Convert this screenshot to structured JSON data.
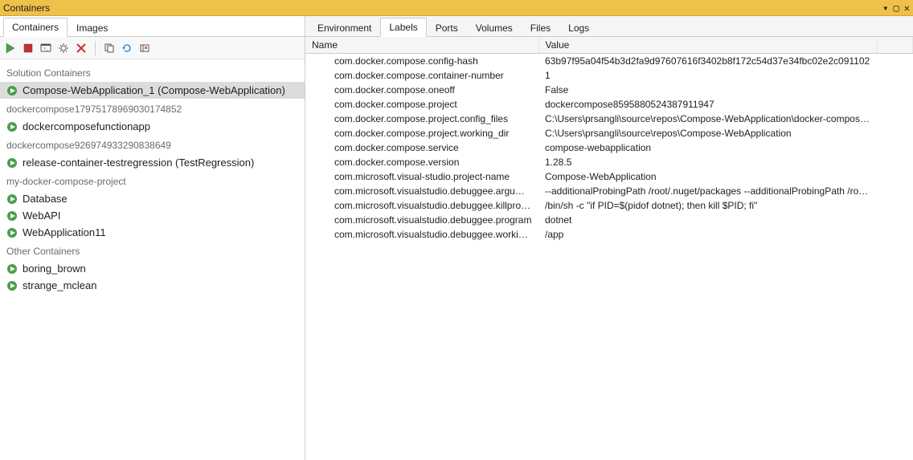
{
  "window": {
    "title": "Containers"
  },
  "leftTabs": [
    {
      "label": "Containers",
      "active": true
    },
    {
      "label": "Images",
      "active": false
    }
  ],
  "toolbar": {
    "icons": [
      "start",
      "stop",
      "attach",
      "settings",
      "delete",
      "branch",
      "refresh",
      "prune"
    ]
  },
  "tree": {
    "groups": [
      {
        "label": "Solution Containers",
        "items": [
          {
            "name": "Compose-WebApplication_1 (Compose-WebApplication)",
            "selected": true
          }
        ]
      },
      {
        "label": "dockercompose17975178969030174852",
        "items": [
          {
            "name": "dockercomposefunctionapp"
          }
        ]
      },
      {
        "label": "dockercompose926974933290838649",
        "items": [
          {
            "name": "release-container-testregression (TestRegression)"
          }
        ]
      },
      {
        "label": "my-docker-compose-project",
        "items": [
          {
            "name": "Database"
          },
          {
            "name": "WebAPI"
          },
          {
            "name": "WebApplication11"
          }
        ]
      },
      {
        "label": "Other Containers",
        "items": [
          {
            "name": "boring_brown"
          },
          {
            "name": "strange_mclean"
          }
        ]
      }
    ]
  },
  "rightTabs": [
    {
      "label": "Environment",
      "active": false
    },
    {
      "label": "Labels",
      "active": true
    },
    {
      "label": "Ports",
      "active": false
    },
    {
      "label": "Volumes",
      "active": false
    },
    {
      "label": "Files",
      "active": false
    },
    {
      "label": "Logs",
      "active": false
    }
  ],
  "grid": {
    "columns": [
      "Name",
      "Value"
    ],
    "rows": [
      {
        "name": "com.docker.compose.config-hash",
        "value": "63b97f95a04f54b3d2fa9d97607616f3402b8f172c54d37e34fbc02e2c091102"
      },
      {
        "name": "com.docker.compose.container-number",
        "value": "1"
      },
      {
        "name": "com.docker.compose.oneoff",
        "value": "False"
      },
      {
        "name": "com.docker.compose.project",
        "value": "dockercompose8595880524387911947"
      },
      {
        "name": "com.docker.compose.project.config_files",
        "value": "C:\\Users\\prsangli\\source\\repos\\Compose-WebApplication\\docker-compose.yml..."
      },
      {
        "name": "com.docker.compose.project.working_dir",
        "value": "C:\\Users\\prsangli\\source\\repos\\Compose-WebApplication"
      },
      {
        "name": "com.docker.compose.service",
        "value": "compose-webapplication"
      },
      {
        "name": "com.docker.compose.version",
        "value": "1.28.5"
      },
      {
        "name": "com.microsoft.visual-studio.project-name",
        "value": "Compose-WebApplication"
      },
      {
        "name": "com.microsoft.visualstudio.debuggee.arguments",
        "value": " --additionalProbingPath /root/.nuget/packages --additionalProbingPath /root/...."
      },
      {
        "name": "com.microsoft.visualstudio.debuggee.killprogram",
        "value": "/bin/sh -c \"if PID=$(pidof dotnet); then kill $PID; fi\""
      },
      {
        "name": "com.microsoft.visualstudio.debuggee.program",
        "value": "dotnet"
      },
      {
        "name": "com.microsoft.visualstudio.debuggee.workingdire...",
        "value": "/app"
      }
    ]
  }
}
